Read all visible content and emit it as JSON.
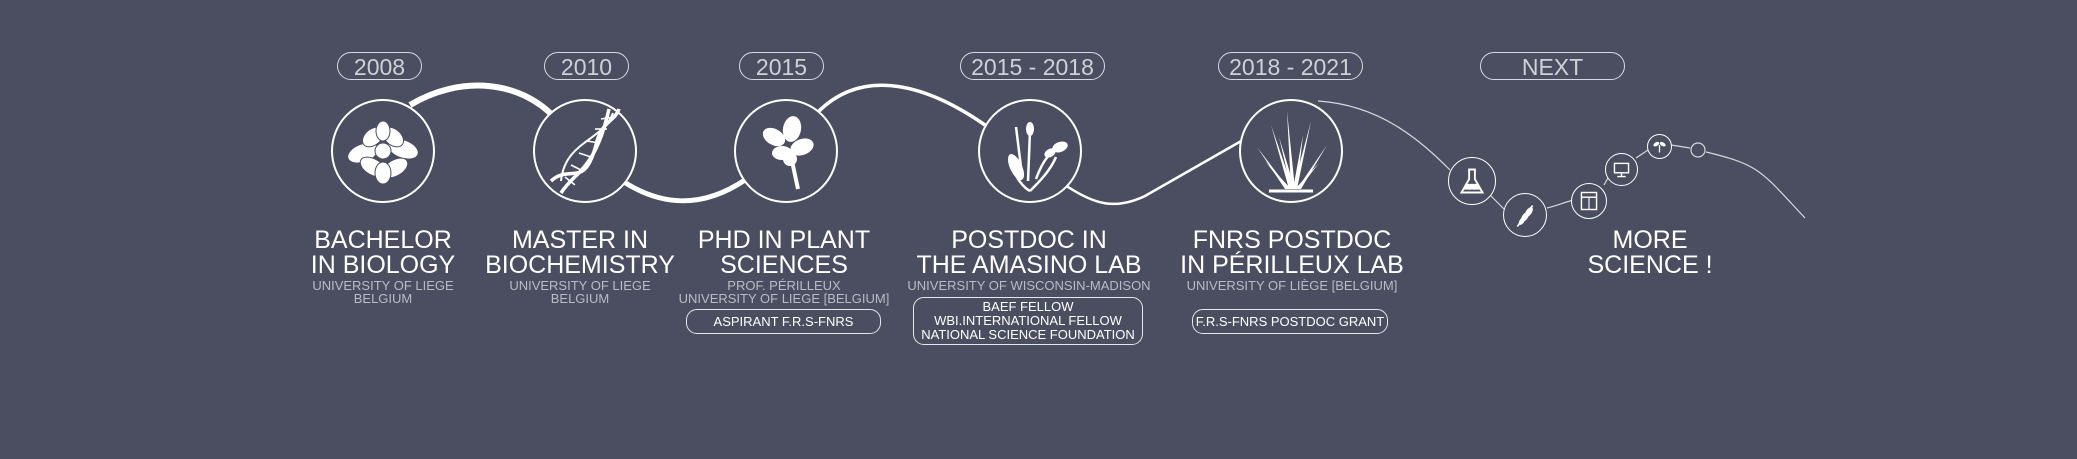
{
  "milestones": [
    {
      "year": "2008",
      "title_1": "BACHELOR",
      "title_2": "IN BIOLOGY",
      "sub_1": "UNIVERSITY OF LIEGE",
      "sub_2": "BELGIUM",
      "icon": "arabidopsis-rosette-icon"
    },
    {
      "year": "2010",
      "title_1": "MASTER IN",
      "title_2": "BIOCHEMISTRY",
      "sub_1": "UNIVERSITY OF LIEGE",
      "sub_2": "BELGIUM",
      "icon": "dna-helix-icon"
    },
    {
      "year": "2015",
      "title_1": "PHD IN PLANT",
      "title_2": "SCIENCES",
      "sub_1": "PROF. PÉRILLEUX",
      "sub_2": "UNIVERSITY OF LIEGE [BELGIUM]",
      "badge": "ASPIRANT F.R.S-FNRS",
      "icon": "flower-icon"
    },
    {
      "year": "2015 - 2018",
      "title_1": "POSTDOC IN",
      "title_2": "THE AMASINO LAB",
      "sub_1": "UNIVERSITY OF WISCONSIN-MADISON",
      "badge_lines": [
        "BAEF FELLOW",
        "WBI.INTERNATIONAL FELLOW",
        "NATIONAL SCIENCE FOUNDATION"
      ],
      "icon": "grass-flower-icon"
    },
    {
      "year": "2018 - 2021",
      "title_1": "FNRS POSTDOC",
      "title_2": "IN PÉRILLEUX LAB",
      "sub_1": "UNIVERSITY OF LIÈGE [BELGIUM]",
      "badge": "F.R.S-FNRS POSTDOC GRANT",
      "icon": "grass-tuft-icon"
    }
  ],
  "next": {
    "label": "NEXT",
    "title_1": "MORE",
    "title_2": "SCIENCE !"
  },
  "colors": {
    "background": "#4a4e60",
    "line": "#ffffff",
    "muted_text": "#b9bbc6"
  }
}
